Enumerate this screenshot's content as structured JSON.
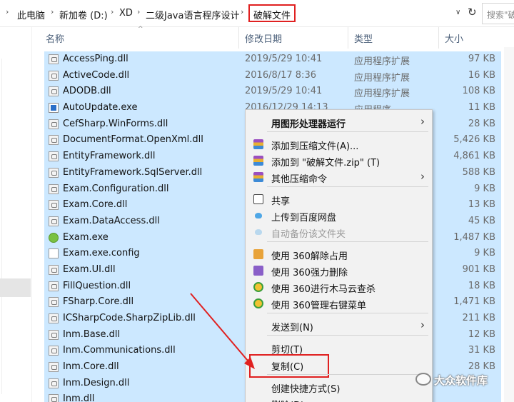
{
  "address_bar": {
    "crumbs": [
      "此电脑",
      "新加卷 (D:)",
      "XD",
      "二级Java语言程序设计"
    ],
    "current": "破解文件",
    "search_placeholder": "搜索\"破解"
  },
  "columns": {
    "name": "名称",
    "modified": "修改日期",
    "type": "类型",
    "size": "大小"
  },
  "files": [
    {
      "name": "AccessPing.dll",
      "date": "2019/5/29 10:41",
      "type": "应用程序扩展",
      "size": "97 KB",
      "icon": "dll-icon"
    },
    {
      "name": "ActiveCode.dll",
      "date": "2016/8/17 8:36",
      "type": "应用程序扩展",
      "size": "16 KB",
      "icon": "dll-icon"
    },
    {
      "name": "ADODB.dll",
      "date": "2019/5/29 10:41",
      "type": "应用程序扩展",
      "size": "108 KB",
      "icon": "dll-icon"
    },
    {
      "name": "AutoUpdate.exe",
      "date": "2016/12/29 14:13",
      "type": "应用程序",
      "size": "11 KB",
      "icon": "exe-icon"
    },
    {
      "name": "CefSharp.WinForms.dll",
      "date": "",
      "type": "",
      "size": "28 KB",
      "icon": "dll-icon"
    },
    {
      "name": "DocumentFormat.OpenXml.dll",
      "date": "",
      "type": "",
      "size": "5,426 KB",
      "icon": "dll-icon"
    },
    {
      "name": "EntityFramework.dll",
      "date": "",
      "type": "",
      "size": "4,861 KB",
      "icon": "dll-icon"
    },
    {
      "name": "EntityFramework.SqlServer.dll",
      "date": "",
      "type": "",
      "size": "588 KB",
      "icon": "dll-icon"
    },
    {
      "name": "Exam.Configuration.dll",
      "date": "",
      "type": "",
      "size": "9 KB",
      "icon": "dll-icon"
    },
    {
      "name": "Exam.Core.dll",
      "date": "",
      "type": "",
      "size": "13 KB",
      "icon": "dll-icon"
    },
    {
      "name": "Exam.DataAccess.dll",
      "date": "",
      "type": "",
      "size": "45 KB",
      "icon": "dll-icon"
    },
    {
      "name": "Exam.exe",
      "date": "",
      "type": "",
      "size": "1,487 KB",
      "icon": "exam-exe-icon"
    },
    {
      "name": "Exam.exe.config",
      "date": "",
      "type": "",
      "size": "9 KB",
      "icon": "config-file-icon"
    },
    {
      "name": "Exam.UI.dll",
      "date": "",
      "type": "",
      "size": "901 KB",
      "icon": "dll-icon"
    },
    {
      "name": "FillQuestion.dll",
      "date": "",
      "type": "",
      "size": "18 KB",
      "icon": "dll-icon"
    },
    {
      "name": "FSharp.Core.dll",
      "date": "",
      "type": "",
      "size": "1,471 KB",
      "icon": "dll-icon"
    },
    {
      "name": "ICSharpCode.SharpZipLib.dll",
      "date": "",
      "type": "",
      "size": "211 KB",
      "icon": "dll-icon"
    },
    {
      "name": "Inm.Base.dll",
      "date": "",
      "type": "",
      "size": "12 KB",
      "icon": "dll-icon"
    },
    {
      "name": "Inm.Communications.dll",
      "date": "",
      "type": "",
      "size": "31 KB",
      "icon": "dll-icon"
    },
    {
      "name": "Inm.Core.dll",
      "date": "",
      "type": "",
      "size": "28 KB",
      "icon": "dll-icon"
    },
    {
      "name": "Inm.Design.dll",
      "date": "",
      "type": "",
      "size": "",
      "icon": "dll-icon"
    },
    {
      "name": "Inm.dll",
      "date": "",
      "type": "",
      "size": "",
      "icon": "dll-icon"
    }
  ],
  "context_menu": {
    "items": [
      {
        "label": "用图形处理器运行",
        "bold": true,
        "submenu": true,
        "icon": ""
      },
      {
        "label": "添加到压缩文件(A)...",
        "icon": "winrar-icon"
      },
      {
        "label": "添加到 \"破解文件.zip\" (T)",
        "icon": "winrar-icon"
      },
      {
        "label": "其他压缩命令",
        "submenu": true,
        "icon": "winrar-icon"
      },
      {
        "label": "共享",
        "icon": "share-icon"
      },
      {
        "label": "上传到百度网盘",
        "icon": "baidu-cloud-icon"
      },
      {
        "label": "自动备份该文件夹",
        "disabled": true,
        "icon": "baidu-cloud-icon"
      },
      {
        "label": "使用 360解除占用",
        "icon": "360-unlock-icon"
      },
      {
        "label": "使用 360强力删除",
        "icon": "360-delete-icon"
      },
      {
        "label": "使用 360进行木马云查杀",
        "icon": "360-scan-icon"
      },
      {
        "label": "使用 360管理右键菜单",
        "icon": "360-scan-icon"
      },
      {
        "label": "发送到(N)",
        "submenu": true,
        "icon": ""
      },
      {
        "label": "剪切(T)",
        "icon": ""
      },
      {
        "label": "复制(C)",
        "icon": ""
      },
      {
        "label": "创建快捷方式(S)",
        "icon": ""
      },
      {
        "label": "删除(D)",
        "icon": ""
      }
    ]
  },
  "watermark": "大众软件库",
  "colors": {
    "selection": "#cce8ff",
    "highlight_border": "#e02020",
    "menu_bg": "#f2f2f2"
  }
}
